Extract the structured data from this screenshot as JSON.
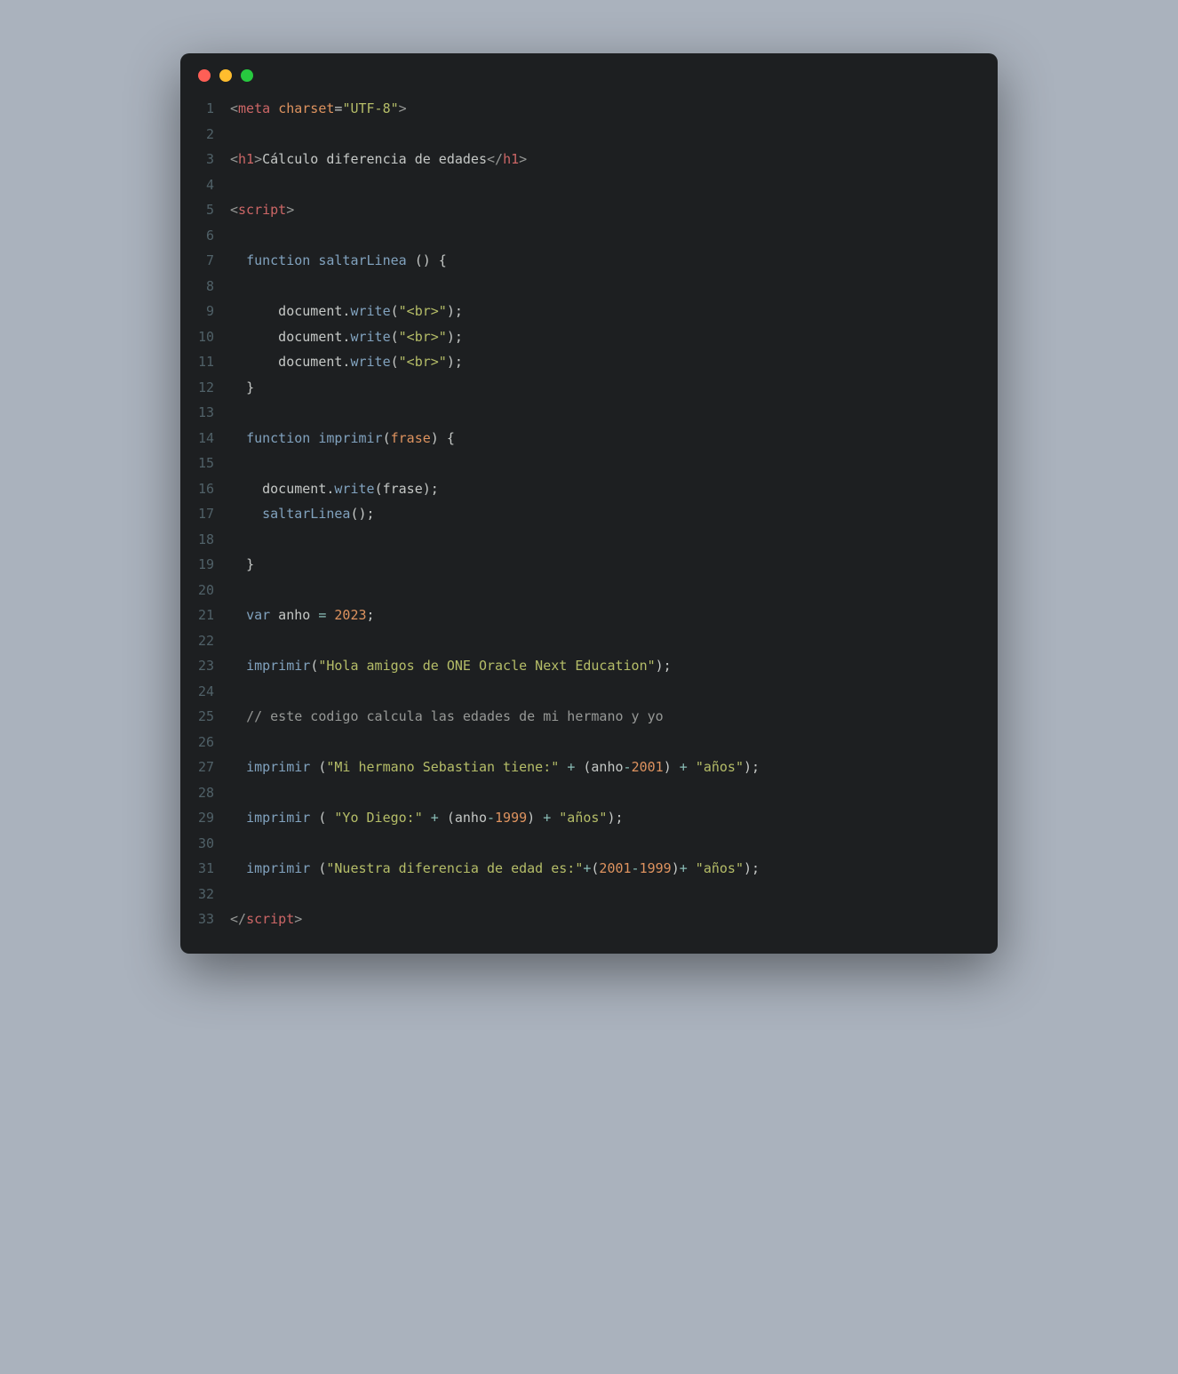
{
  "window": {
    "buttons": [
      "close",
      "minimize",
      "zoom"
    ]
  },
  "colors": {
    "bg": "#aab2bd",
    "editor_bg": "#1d1f21",
    "text": "#c5c8c6",
    "lineno": "#506168",
    "red": "#ff5f56",
    "yellow": "#ffbd2e",
    "green": "#27c93f",
    "tag": "#cc6666",
    "attr": "#de935f",
    "string": "#b5bd68",
    "keyword": "#81a2be",
    "comment": "#969896",
    "number": "#de935f",
    "operator": "#8abeb7"
  },
  "lines": [
    {
      "n": 1,
      "tokens": [
        {
          "c": "bracket",
          "t": "<"
        },
        {
          "c": "tag",
          "t": "meta"
        },
        {
          "c": "text",
          "t": " "
        },
        {
          "c": "attr",
          "t": "charset"
        },
        {
          "c": "punct",
          "t": "="
        },
        {
          "c": "string",
          "t": "\"UTF-8\""
        },
        {
          "c": "bracket",
          "t": ">"
        }
      ]
    },
    {
      "n": 2,
      "tokens": []
    },
    {
      "n": 3,
      "tokens": [
        {
          "c": "bracket",
          "t": "<"
        },
        {
          "c": "tag",
          "t": "h1"
        },
        {
          "c": "bracket",
          "t": ">"
        },
        {
          "c": "text",
          "t": "Cálculo diferencia de edades"
        },
        {
          "c": "bracket",
          "t": "</"
        },
        {
          "c": "tag",
          "t": "h1"
        },
        {
          "c": "bracket",
          "t": ">"
        }
      ]
    },
    {
      "n": 4,
      "tokens": []
    },
    {
      "n": 5,
      "tokens": [
        {
          "c": "bracket",
          "t": "<"
        },
        {
          "c": "tag",
          "t": "script"
        },
        {
          "c": "bracket",
          "t": ">"
        }
      ]
    },
    {
      "n": 6,
      "tokens": []
    },
    {
      "n": 7,
      "tokens": [
        {
          "c": "text",
          "t": "  "
        },
        {
          "c": "keyword",
          "t": "function"
        },
        {
          "c": "text",
          "t": " "
        },
        {
          "c": "fname",
          "t": "saltarLinea"
        },
        {
          "c": "text",
          "t": " "
        },
        {
          "c": "punct",
          "t": "() {"
        }
      ]
    },
    {
      "n": 8,
      "tokens": []
    },
    {
      "n": 9,
      "tokens": [
        {
          "c": "text",
          "t": "      document."
        },
        {
          "c": "fname",
          "t": "write"
        },
        {
          "c": "punct",
          "t": "("
        },
        {
          "c": "string",
          "t": "\"<br>\""
        },
        {
          "c": "punct",
          "t": ");"
        }
      ]
    },
    {
      "n": 10,
      "tokens": [
        {
          "c": "text",
          "t": "      document."
        },
        {
          "c": "fname",
          "t": "write"
        },
        {
          "c": "punct",
          "t": "("
        },
        {
          "c": "string",
          "t": "\"<br>\""
        },
        {
          "c": "punct",
          "t": ");"
        }
      ]
    },
    {
      "n": 11,
      "tokens": [
        {
          "c": "text",
          "t": "      document."
        },
        {
          "c": "fname",
          "t": "write"
        },
        {
          "c": "punct",
          "t": "("
        },
        {
          "c": "string",
          "t": "\"<br>\""
        },
        {
          "c": "punct",
          "t": ");"
        }
      ]
    },
    {
      "n": 12,
      "tokens": [
        {
          "c": "text",
          "t": "  "
        },
        {
          "c": "punct",
          "t": "}"
        }
      ]
    },
    {
      "n": 13,
      "tokens": []
    },
    {
      "n": 14,
      "tokens": [
        {
          "c": "text",
          "t": "  "
        },
        {
          "c": "keyword",
          "t": "function"
        },
        {
          "c": "text",
          "t": " "
        },
        {
          "c": "fname",
          "t": "imprimir"
        },
        {
          "c": "punct",
          "t": "("
        },
        {
          "c": "prop",
          "t": "frase"
        },
        {
          "c": "punct",
          "t": ") {"
        }
      ]
    },
    {
      "n": 15,
      "tokens": []
    },
    {
      "n": 16,
      "tokens": [
        {
          "c": "text",
          "t": "    document."
        },
        {
          "c": "fname",
          "t": "write"
        },
        {
          "c": "punct",
          "t": "(frase);"
        }
      ]
    },
    {
      "n": 17,
      "tokens": [
        {
          "c": "text",
          "t": "    "
        },
        {
          "c": "fname",
          "t": "saltarLinea"
        },
        {
          "c": "punct",
          "t": "();"
        }
      ]
    },
    {
      "n": 18,
      "tokens": []
    },
    {
      "n": 19,
      "tokens": [
        {
          "c": "text",
          "t": "  "
        },
        {
          "c": "punct",
          "t": "}"
        }
      ]
    },
    {
      "n": 20,
      "tokens": []
    },
    {
      "n": 21,
      "tokens": [
        {
          "c": "text",
          "t": "  "
        },
        {
          "c": "keyword",
          "t": "var"
        },
        {
          "c": "text",
          "t": " anho "
        },
        {
          "c": "op",
          "t": "="
        },
        {
          "c": "text",
          "t": " "
        },
        {
          "c": "num",
          "t": "2023"
        },
        {
          "c": "punct",
          "t": ";"
        }
      ]
    },
    {
      "n": 22,
      "tokens": []
    },
    {
      "n": 23,
      "tokens": [
        {
          "c": "text",
          "t": "  "
        },
        {
          "c": "fname",
          "t": "imprimir"
        },
        {
          "c": "punct",
          "t": "("
        },
        {
          "c": "string",
          "t": "\"Hola amigos de ONE Oracle Next Education\""
        },
        {
          "c": "punct",
          "t": ");"
        }
      ]
    },
    {
      "n": 24,
      "tokens": []
    },
    {
      "n": 25,
      "tokens": [
        {
          "c": "text",
          "t": "  "
        },
        {
          "c": "comment",
          "t": "// este codigo calcula las edades de mi hermano y yo"
        }
      ]
    },
    {
      "n": 26,
      "tokens": []
    },
    {
      "n": 27,
      "tokens": [
        {
          "c": "text",
          "t": "  "
        },
        {
          "c": "fname",
          "t": "imprimir"
        },
        {
          "c": "text",
          "t": " "
        },
        {
          "c": "punct",
          "t": "("
        },
        {
          "c": "string",
          "t": "\"Mi hermano Sebastian tiene:\""
        },
        {
          "c": "text",
          "t": " "
        },
        {
          "c": "op",
          "t": "+"
        },
        {
          "c": "text",
          "t": " "
        },
        {
          "c": "punct",
          "t": "("
        },
        {
          "c": "text",
          "t": "anho"
        },
        {
          "c": "op",
          "t": "-"
        },
        {
          "c": "num",
          "t": "2001"
        },
        {
          "c": "punct",
          "t": ")"
        },
        {
          "c": "text",
          "t": " "
        },
        {
          "c": "op",
          "t": "+"
        },
        {
          "c": "text",
          "t": " "
        },
        {
          "c": "string",
          "t": "\"años\""
        },
        {
          "c": "punct",
          "t": ");"
        }
      ]
    },
    {
      "n": 28,
      "tokens": []
    },
    {
      "n": 29,
      "tokens": [
        {
          "c": "text",
          "t": "  "
        },
        {
          "c": "fname",
          "t": "imprimir"
        },
        {
          "c": "text",
          "t": " "
        },
        {
          "c": "punct",
          "t": "( "
        },
        {
          "c": "string",
          "t": "\"Yo Diego:\""
        },
        {
          "c": "text",
          "t": " "
        },
        {
          "c": "op",
          "t": "+"
        },
        {
          "c": "text",
          "t": " "
        },
        {
          "c": "punct",
          "t": "("
        },
        {
          "c": "text",
          "t": "anho"
        },
        {
          "c": "op",
          "t": "-"
        },
        {
          "c": "num",
          "t": "1999"
        },
        {
          "c": "punct",
          "t": ")"
        },
        {
          "c": "text",
          "t": " "
        },
        {
          "c": "op",
          "t": "+"
        },
        {
          "c": "text",
          "t": " "
        },
        {
          "c": "string",
          "t": "\"años\""
        },
        {
          "c": "punct",
          "t": ");"
        }
      ]
    },
    {
      "n": 30,
      "tokens": []
    },
    {
      "n": 31,
      "tokens": [
        {
          "c": "text",
          "t": "  "
        },
        {
          "c": "fname",
          "t": "imprimir"
        },
        {
          "c": "text",
          "t": " "
        },
        {
          "c": "punct",
          "t": "("
        },
        {
          "c": "string",
          "t": "\"Nuestra diferencia de edad es:\""
        },
        {
          "c": "op",
          "t": "+"
        },
        {
          "c": "punct",
          "t": "("
        },
        {
          "c": "num",
          "t": "2001"
        },
        {
          "c": "op",
          "t": "-"
        },
        {
          "c": "num",
          "t": "1999"
        },
        {
          "c": "punct",
          "t": ")"
        },
        {
          "c": "op",
          "t": "+"
        },
        {
          "c": "text",
          "t": " "
        },
        {
          "c": "string",
          "t": "\"años\""
        },
        {
          "c": "punct",
          "t": ");"
        }
      ]
    },
    {
      "n": 32,
      "tokens": []
    },
    {
      "n": 33,
      "tokens": [
        {
          "c": "bracket",
          "t": "</"
        },
        {
          "c": "tag",
          "t": "script"
        },
        {
          "c": "bracket",
          "t": ">"
        }
      ]
    }
  ]
}
